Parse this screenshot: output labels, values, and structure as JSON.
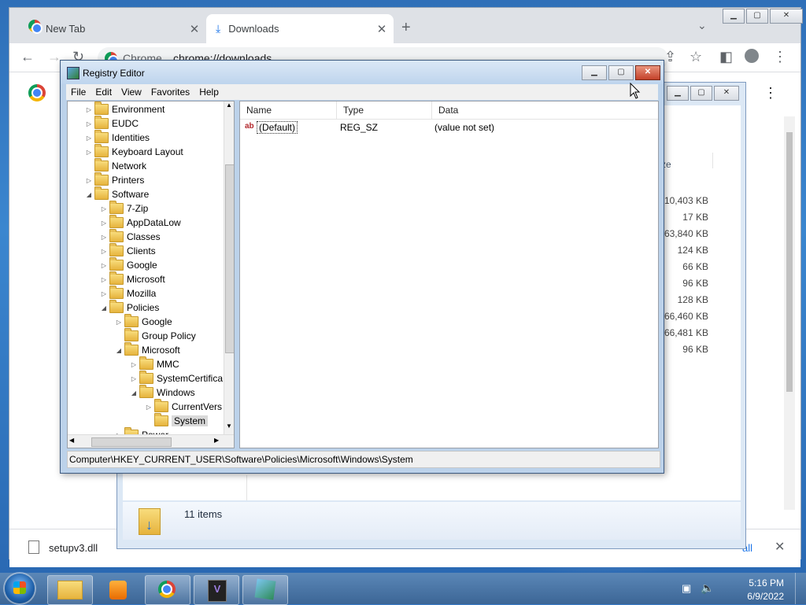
{
  "chrome": {
    "tabs": [
      {
        "label": "New Tab",
        "icon": "chrome-icon"
      },
      {
        "label": "Downloads",
        "icon": "download-icon"
      }
    ],
    "omnibox": {
      "site_label": "Chrome",
      "url": "chrome://downloads"
    },
    "download_shelf": {
      "file_name": "setupv3.dll",
      "show_all_label": "all"
    }
  },
  "explorer": {
    "column_partial": "ze",
    "sizes": [
      "10,403 KB",
      "17 KB",
      "163,840 KB",
      "124 KB",
      "66 KB",
      "96 KB",
      "128 KB",
      "66,460 KB",
      "66,481 KB",
      "96 KB"
    ],
    "item_count": "11 items"
  },
  "regedit": {
    "title": "Registry Editor",
    "menu": [
      "File",
      "Edit",
      "View",
      "Favorites",
      "Help"
    ],
    "tree": [
      {
        "label": "Environment",
        "level": 0,
        "arrow": "closed"
      },
      {
        "label": "EUDC",
        "level": 0,
        "arrow": "closed"
      },
      {
        "label": "Identities",
        "level": 0,
        "arrow": "closed"
      },
      {
        "label": "Keyboard Layout",
        "level": 0,
        "arrow": "closed"
      },
      {
        "label": "Network",
        "level": 0,
        "arrow": "none"
      },
      {
        "label": "Printers",
        "level": 0,
        "arrow": "closed"
      },
      {
        "label": "Software",
        "level": 0,
        "arrow": "open"
      },
      {
        "label": "7-Zip",
        "level": 1,
        "arrow": "closed"
      },
      {
        "label": "AppDataLow",
        "level": 1,
        "arrow": "closed"
      },
      {
        "label": "Classes",
        "level": 1,
        "arrow": "closed"
      },
      {
        "label": "Clients",
        "level": 1,
        "arrow": "closed"
      },
      {
        "label": "Google",
        "level": 1,
        "arrow": "closed"
      },
      {
        "label": "Microsoft",
        "level": 1,
        "arrow": "closed"
      },
      {
        "label": "Mozilla",
        "level": 1,
        "arrow": "closed"
      },
      {
        "label": "Policies",
        "level": 1,
        "arrow": "open"
      },
      {
        "label": "Google",
        "level": 2,
        "arrow": "closed"
      },
      {
        "label": "Group Policy",
        "level": 2,
        "arrow": "none"
      },
      {
        "label": "Microsoft",
        "level": 2,
        "arrow": "open"
      },
      {
        "label": "MMC",
        "level": 3,
        "arrow": "closed"
      },
      {
        "label": "SystemCertifica",
        "level": 3,
        "arrow": "closed"
      },
      {
        "label": "Windows",
        "level": 3,
        "arrow": "open"
      },
      {
        "label": "CurrentVers",
        "level": 4,
        "arrow": "closed"
      },
      {
        "label": "System",
        "level": 4,
        "arrow": "none",
        "selected": true
      },
      {
        "label": "Power",
        "level": 2,
        "arrow": "closed"
      }
    ],
    "columns": [
      "Name",
      "Type",
      "Data"
    ],
    "values": [
      {
        "name": "(Default)",
        "type": "REG_SZ",
        "data": "(value not set)"
      }
    ],
    "status_path": "Computer\\HKEY_CURRENT_USER\\Software\\Policies\\Microsoft\\Windows\\System"
  },
  "taskbar": {
    "buttons": [
      "explorer-icon",
      "media-player-icon",
      "chrome-icon",
      "visual-studio-icon",
      "regedit-icon"
    ],
    "time": "5:16 PM",
    "date": "6/9/2022"
  }
}
